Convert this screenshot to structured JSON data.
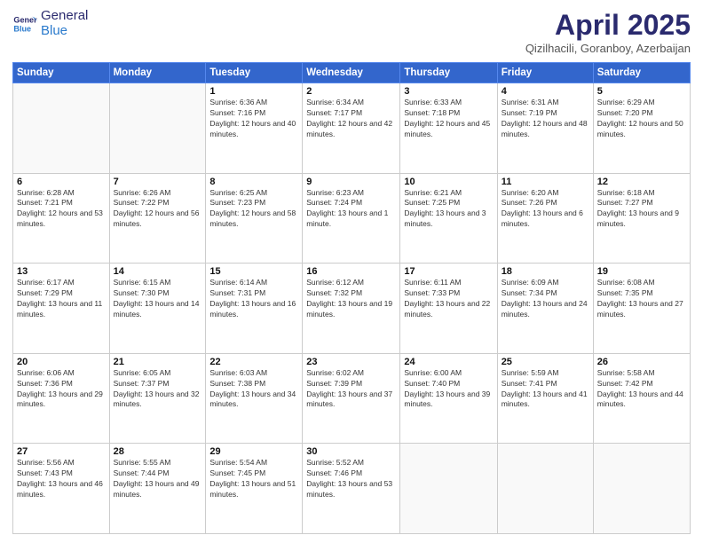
{
  "logo": {
    "line1": "General",
    "line2": "Blue"
  },
  "title": "April 2025",
  "subtitle": "Qizilhacili, Goranboy, Azerbaijan",
  "days_of_week": [
    "Sunday",
    "Monday",
    "Tuesday",
    "Wednesday",
    "Thursday",
    "Friday",
    "Saturday"
  ],
  "weeks": [
    [
      {
        "day": "",
        "info": ""
      },
      {
        "day": "",
        "info": ""
      },
      {
        "day": "1",
        "info": "Sunrise: 6:36 AM\nSunset: 7:16 PM\nDaylight: 12 hours and 40 minutes."
      },
      {
        "day": "2",
        "info": "Sunrise: 6:34 AM\nSunset: 7:17 PM\nDaylight: 12 hours and 42 minutes."
      },
      {
        "day": "3",
        "info": "Sunrise: 6:33 AM\nSunset: 7:18 PM\nDaylight: 12 hours and 45 minutes."
      },
      {
        "day": "4",
        "info": "Sunrise: 6:31 AM\nSunset: 7:19 PM\nDaylight: 12 hours and 48 minutes."
      },
      {
        "day": "5",
        "info": "Sunrise: 6:29 AM\nSunset: 7:20 PM\nDaylight: 12 hours and 50 minutes."
      }
    ],
    [
      {
        "day": "6",
        "info": "Sunrise: 6:28 AM\nSunset: 7:21 PM\nDaylight: 12 hours and 53 minutes."
      },
      {
        "day": "7",
        "info": "Sunrise: 6:26 AM\nSunset: 7:22 PM\nDaylight: 12 hours and 56 minutes."
      },
      {
        "day": "8",
        "info": "Sunrise: 6:25 AM\nSunset: 7:23 PM\nDaylight: 12 hours and 58 minutes."
      },
      {
        "day": "9",
        "info": "Sunrise: 6:23 AM\nSunset: 7:24 PM\nDaylight: 13 hours and 1 minute."
      },
      {
        "day": "10",
        "info": "Sunrise: 6:21 AM\nSunset: 7:25 PM\nDaylight: 13 hours and 3 minutes."
      },
      {
        "day": "11",
        "info": "Sunrise: 6:20 AM\nSunset: 7:26 PM\nDaylight: 13 hours and 6 minutes."
      },
      {
        "day": "12",
        "info": "Sunrise: 6:18 AM\nSunset: 7:27 PM\nDaylight: 13 hours and 9 minutes."
      }
    ],
    [
      {
        "day": "13",
        "info": "Sunrise: 6:17 AM\nSunset: 7:29 PM\nDaylight: 13 hours and 11 minutes."
      },
      {
        "day": "14",
        "info": "Sunrise: 6:15 AM\nSunset: 7:30 PM\nDaylight: 13 hours and 14 minutes."
      },
      {
        "day": "15",
        "info": "Sunrise: 6:14 AM\nSunset: 7:31 PM\nDaylight: 13 hours and 16 minutes."
      },
      {
        "day": "16",
        "info": "Sunrise: 6:12 AM\nSunset: 7:32 PM\nDaylight: 13 hours and 19 minutes."
      },
      {
        "day": "17",
        "info": "Sunrise: 6:11 AM\nSunset: 7:33 PM\nDaylight: 13 hours and 22 minutes."
      },
      {
        "day": "18",
        "info": "Sunrise: 6:09 AM\nSunset: 7:34 PM\nDaylight: 13 hours and 24 minutes."
      },
      {
        "day": "19",
        "info": "Sunrise: 6:08 AM\nSunset: 7:35 PM\nDaylight: 13 hours and 27 minutes."
      }
    ],
    [
      {
        "day": "20",
        "info": "Sunrise: 6:06 AM\nSunset: 7:36 PM\nDaylight: 13 hours and 29 minutes."
      },
      {
        "day": "21",
        "info": "Sunrise: 6:05 AM\nSunset: 7:37 PM\nDaylight: 13 hours and 32 minutes."
      },
      {
        "day": "22",
        "info": "Sunrise: 6:03 AM\nSunset: 7:38 PM\nDaylight: 13 hours and 34 minutes."
      },
      {
        "day": "23",
        "info": "Sunrise: 6:02 AM\nSunset: 7:39 PM\nDaylight: 13 hours and 37 minutes."
      },
      {
        "day": "24",
        "info": "Sunrise: 6:00 AM\nSunset: 7:40 PM\nDaylight: 13 hours and 39 minutes."
      },
      {
        "day": "25",
        "info": "Sunrise: 5:59 AM\nSunset: 7:41 PM\nDaylight: 13 hours and 41 minutes."
      },
      {
        "day": "26",
        "info": "Sunrise: 5:58 AM\nSunset: 7:42 PM\nDaylight: 13 hours and 44 minutes."
      }
    ],
    [
      {
        "day": "27",
        "info": "Sunrise: 5:56 AM\nSunset: 7:43 PM\nDaylight: 13 hours and 46 minutes."
      },
      {
        "day": "28",
        "info": "Sunrise: 5:55 AM\nSunset: 7:44 PM\nDaylight: 13 hours and 49 minutes."
      },
      {
        "day": "29",
        "info": "Sunrise: 5:54 AM\nSunset: 7:45 PM\nDaylight: 13 hours and 51 minutes."
      },
      {
        "day": "30",
        "info": "Sunrise: 5:52 AM\nSunset: 7:46 PM\nDaylight: 13 hours and 53 minutes."
      },
      {
        "day": "",
        "info": ""
      },
      {
        "day": "",
        "info": ""
      },
      {
        "day": "",
        "info": ""
      }
    ]
  ]
}
